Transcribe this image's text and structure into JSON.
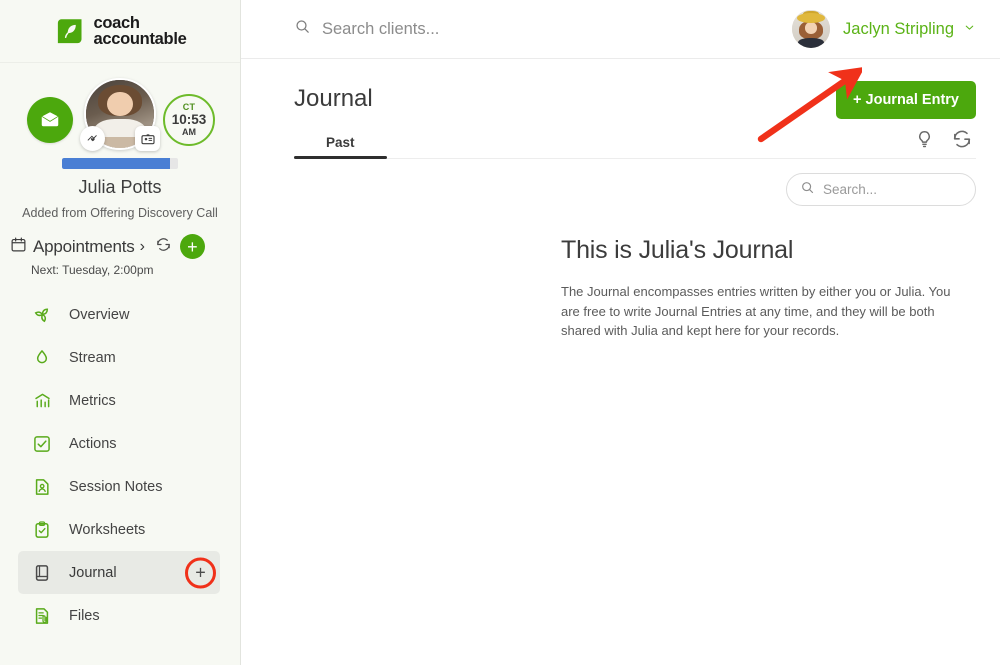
{
  "brand": {
    "logo_line1": "coach",
    "logo_line2": "accountable",
    "logo_color": "#4ca80d",
    "accent_green": "#4ca80d",
    "link_green": "#5bb317",
    "annotation_red": "#f0311a",
    "progress_blue": "#4a7fd4"
  },
  "sidebar": {
    "client": {
      "name": "Julia Potts",
      "source_note": "Added from Offering Discovery Call",
      "progress_percent": 93,
      "mail_icon": "envelope-icon",
      "badges": [
        "handshake-heart-badge-icon",
        "id-card-badge-icon"
      ],
      "time": {
        "timezone": "CT",
        "clock": "10:53",
        "meridiem": "AM"
      }
    },
    "appointments": {
      "label": "Appointments",
      "chevron": "›",
      "refresh_icon": "refresh-icon",
      "add_icon": "plus-icon",
      "next_label": "Next: Tuesday, 2:00pm"
    },
    "nav_items": [
      {
        "label": "Overview",
        "icon": "leaf-pinwheel-icon",
        "active": false
      },
      {
        "label": "Stream",
        "icon": "droplet-icon",
        "active": false
      },
      {
        "label": "Metrics",
        "icon": "bar-chart-icon",
        "active": false
      },
      {
        "label": "Actions",
        "icon": "check-square-icon",
        "active": false
      },
      {
        "label": "Session Notes",
        "icon": "person-note-icon",
        "active": false
      },
      {
        "label": "Worksheets",
        "icon": "clipboard-check-icon",
        "active": false
      },
      {
        "label": "Journal",
        "icon": "book-icon",
        "active": true
      },
      {
        "label": "Files",
        "icon": "file-clip-icon",
        "active": false
      }
    ],
    "journal_add_icon": "plus-icon"
  },
  "topbar": {
    "search_placeholder": "Search clients...",
    "search_value": "",
    "search_icon": "search-icon",
    "user_name": "Jaclyn Stripling",
    "user_caret": "⌄",
    "avatar": "user-avatar"
  },
  "page": {
    "title": "Journal",
    "entry_button": "+ Journal Entry",
    "tabs": [
      {
        "label": "Past",
        "active": true
      }
    ],
    "tools": [
      {
        "name": "lightbulb-icon"
      },
      {
        "name": "refresh-icon"
      }
    ],
    "search": {
      "placeholder": "Search...",
      "value": "",
      "icon": "search-icon"
    }
  },
  "content": {
    "heading": "This is Julia's Journal",
    "paragraph": "The Journal encompasses entries written by either you or Julia. You are free to write Journal Entries at any time, and they will be both shared with Julia and kept here for your records."
  }
}
